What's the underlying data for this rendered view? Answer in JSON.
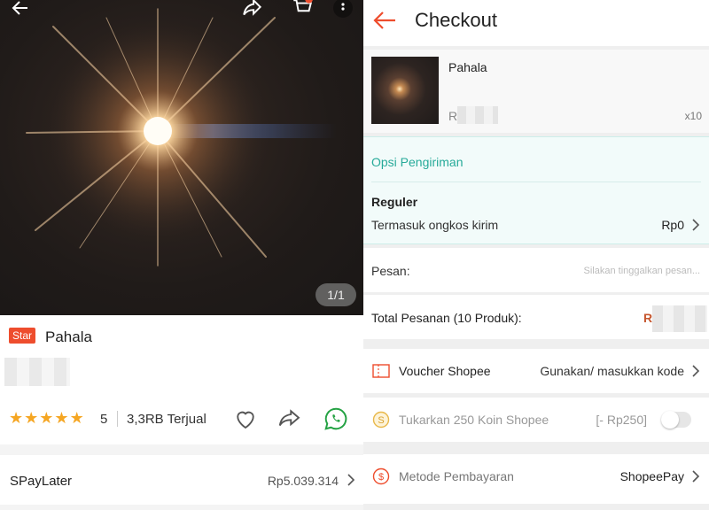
{
  "product": {
    "badge": "Star",
    "name": "Pahala",
    "image_counter": "1/1",
    "rating": "5",
    "stars": 5,
    "sold": "3,3RB Terjual",
    "spaylater_label": "SPayLater",
    "spaylater_value": "Rp5.039.314"
  },
  "checkout": {
    "title": "Checkout",
    "item": {
      "name": "Pahala",
      "price": "R",
      "qty": "x10"
    },
    "shipping": {
      "heading": "Opsi Pengiriman",
      "name": "Reguler",
      "desc": "Termasuk ongkos kirim",
      "cost": "Rp0"
    },
    "message": {
      "label": "Pesan:",
      "placeholder": "Silakan tinggalkan pesan..."
    },
    "total": {
      "label": "Total Pesanan (10 Produk):",
      "value": "R"
    },
    "voucher": {
      "label": "Voucher Shopee",
      "value": "Gunakan/ masukkan kode"
    },
    "coins": {
      "label": "Tukarkan 250 Koin Shopee",
      "value": "[- Rp250]"
    },
    "payment": {
      "label": "Metode Pembayaran",
      "value": "ShopeePay"
    }
  },
  "colors": {
    "accent": "#ee4d2d",
    "teal": "#26aa99",
    "star": "#f5a623",
    "total": "#c6572f"
  },
  "icons": [
    "back-arrow-icon",
    "share-icon",
    "cart-icon",
    "more-icon",
    "heart-icon",
    "share-arrow-icon",
    "whatsapp-icon",
    "chevron-right-icon",
    "voucher-icon",
    "coin-icon",
    "payment-icon"
  ]
}
